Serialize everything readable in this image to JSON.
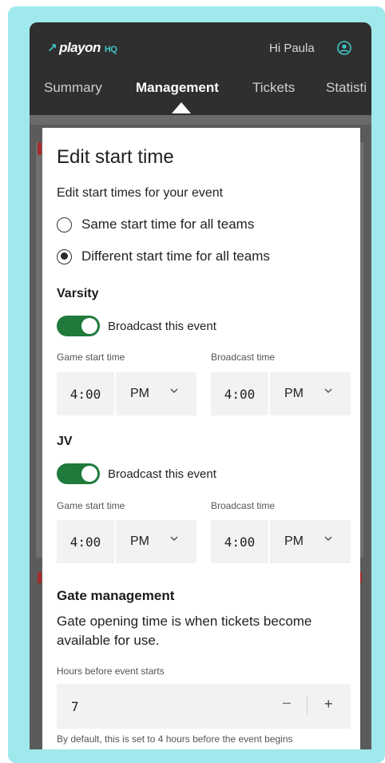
{
  "header": {
    "logo_text": "playon",
    "logo_suffix": "HQ",
    "greeting": "Hi Paula",
    "user_icon": "user-circle-icon"
  },
  "tabs": [
    {
      "label": "Summary",
      "active": false
    },
    {
      "label": "Management",
      "active": true
    },
    {
      "label": "Tickets",
      "active": false
    },
    {
      "label": "Statisti",
      "active": false
    }
  ],
  "modal": {
    "title": "Edit start time",
    "subtitle": "Edit start times for your event",
    "options": [
      {
        "label": "Same start time for all teams",
        "checked": false
      },
      {
        "label": "Different start time for all teams",
        "checked": true
      }
    ],
    "teams": [
      {
        "name": "Varsity",
        "broadcast_label": "Broadcast this event",
        "broadcast_on": true,
        "game_start_label": "Game start time",
        "game_time": "4:00",
        "game_ampm": "PM",
        "broadcast_time_label": "Broadcast time",
        "broadcast_time": "4:00",
        "broadcast_ampm": "PM"
      },
      {
        "name": "JV",
        "broadcast_label": "Broadcast this event",
        "broadcast_on": true,
        "game_start_label": "Game start time",
        "game_time": "4:00",
        "game_ampm": "PM",
        "broadcast_time_label": "Broadcast time",
        "broadcast_time": "4:00",
        "broadcast_ampm": "PM"
      }
    ],
    "gate": {
      "title": "Gate management",
      "description": "Gate opening time is when tickets become available for use.",
      "hours_label": "Hours before event starts",
      "hours_value": "7",
      "minus_label": "−",
      "plus_label": "+",
      "helper": "By default, this is set to 4 hours before the event begins"
    }
  },
  "colors": {
    "toggle_on": "#1f7a3b",
    "brand_accent": "#3ec8c5",
    "frame": "#9fe8ec"
  }
}
